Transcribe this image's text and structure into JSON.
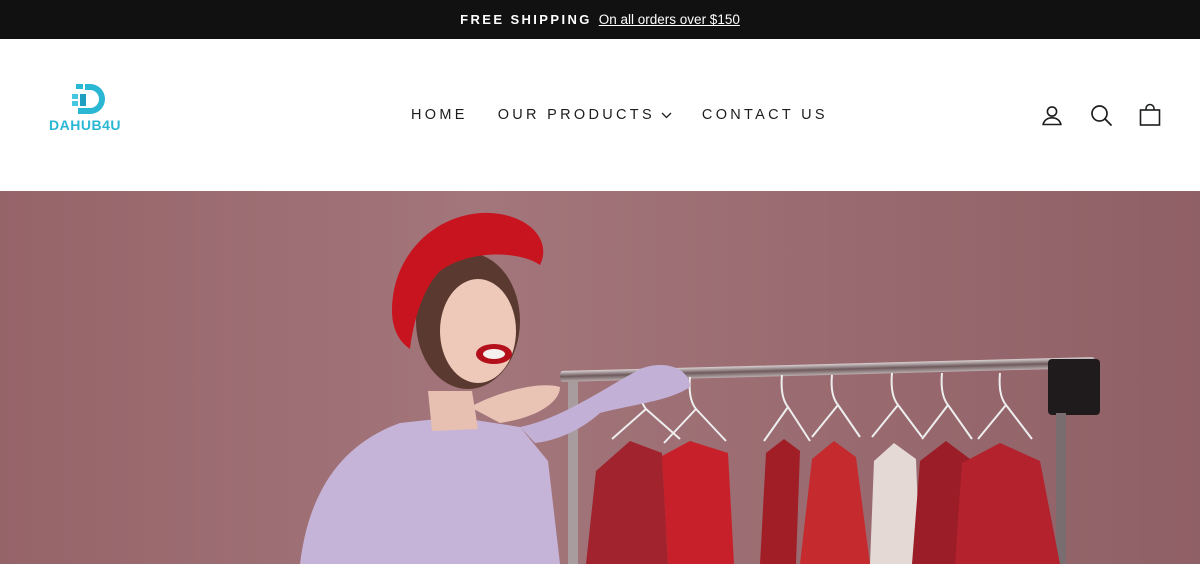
{
  "announcement": {
    "strong_text": "FREE SHIPPING",
    "link_text": "On all orders over $150"
  },
  "logo": {
    "text": "DAHUB4U",
    "color": "#2ab7d4"
  },
  "nav": {
    "items": [
      {
        "label": "HOME"
      },
      {
        "label": "OUR PRODUCTS",
        "has_dropdown": true
      },
      {
        "label": "CONTACT US"
      }
    ]
  },
  "header_icons": [
    "account-icon",
    "search-icon",
    "cart-icon"
  ],
  "hero": {
    "image": "woman-with-clothing-rack",
    "background_color": "#9b6d72"
  },
  "colors": {
    "announcement_bg": "#111111",
    "text": "#1c1d1d",
    "accent": "#2ab7d4"
  }
}
